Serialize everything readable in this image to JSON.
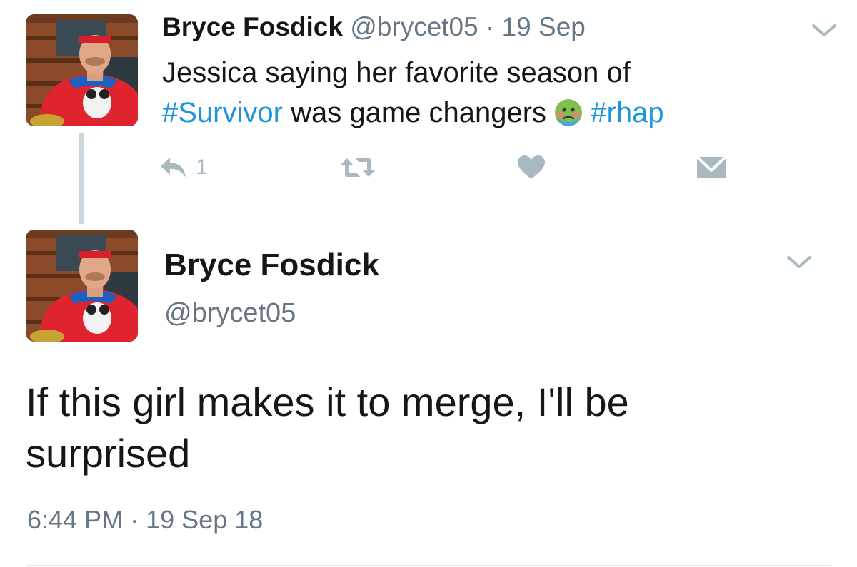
{
  "colors": {
    "text": "#14171a",
    "secondary": "#657786",
    "hashtag": "#1b95e0",
    "icon": "#aab8c2",
    "thread_line": "#ccd6dd"
  },
  "tweet": {
    "author_name": "Bryce Fosdick",
    "handle": "@brycet05",
    "separator": "·",
    "date": "19 Sep",
    "text_part1": "Jessica saying her favorite season of",
    "hashtag_survivor": "#Survivor",
    "text_part2": "was game changers",
    "emoji": "nauseated-face-emoji",
    "hashtag_rhap": "#rhap",
    "reply_count": "1",
    "actions": [
      "reply-icon",
      "retweet-icon",
      "like-icon",
      "direct-message-icon"
    ]
  },
  "reply": {
    "author_name": "Bryce Fosdick",
    "handle": "@brycet05",
    "text": "If this girl makes it to merge, I'll be surprised",
    "time": "6:44 PM",
    "separator": "·",
    "date": "19 Sep 18"
  }
}
